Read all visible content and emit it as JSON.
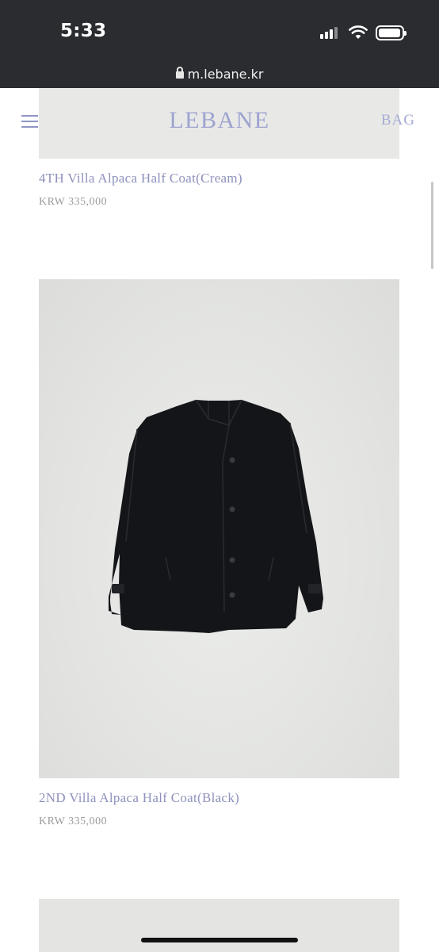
{
  "status_bar": {
    "time": "5:33",
    "url": "m.lebane.kr"
  },
  "header": {
    "logo": "LEBANE",
    "bag_label": "BAG"
  },
  "products": [
    {
      "name": "4TH Villa Alpaca Half Coat(Cream)",
      "price": "KRW 335,000"
    },
    {
      "name": "2ND Villa Alpaca Half Coat(Black)",
      "price": "KRW 335,000"
    }
  ],
  "icons": [
    "lock-icon",
    "signal-icon",
    "wifi-icon",
    "battery-icon",
    "hamburger-menu-icon"
  ],
  "colors": {
    "brand": "#9ea3cf",
    "status_bar": "#2a2c30",
    "price": "#9c9c9c",
    "coat": "#141518"
  }
}
